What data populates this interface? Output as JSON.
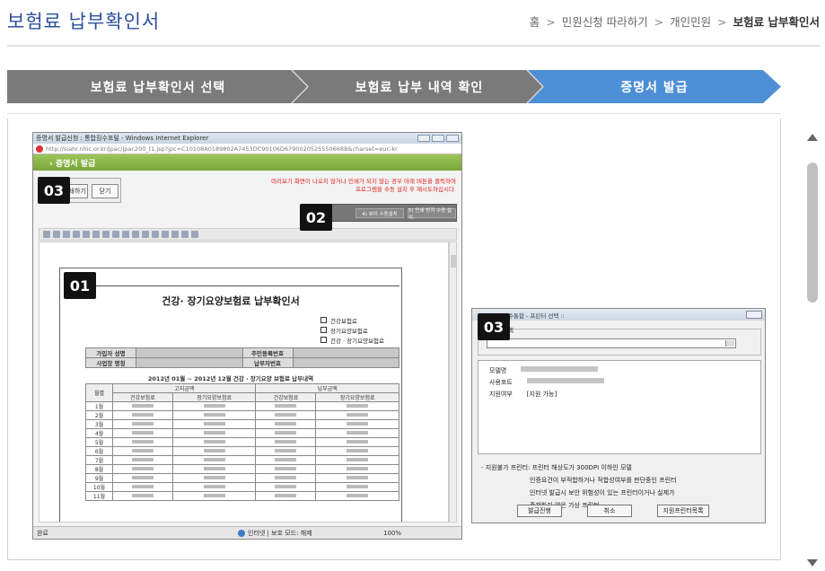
{
  "header": {
    "title": "보험료 납부확인서",
    "breadcrumb": [
      "홈",
      "민원신청 따라하기",
      "개인민원",
      "보험료 납부확인서"
    ],
    "separator": ">"
  },
  "steps": [
    {
      "label": "보험료 납부확인서 선택",
      "state": "done"
    },
    {
      "label": "보험료 납부 내역 확인",
      "state": "done"
    },
    {
      "label": "증명서 발급",
      "state": "active"
    }
  ],
  "colors": {
    "title": "#2b4f9c",
    "step_inactive": "#7a7a7a",
    "step_active": "#4d8fd6",
    "ie_green": "#7aa63a",
    "notice_red": "#e02020"
  },
  "ie_window": {
    "title": "증명서 발급신청 : 통합징수포털 - Windows Internet Explorer",
    "address": "http://siahr.nhic.or.kr/jpac/jpac200_t1.jsp?jpc=C10108A0189802A7453DC90106D6790020525550668B&charset=euc-kr",
    "green_bar": "› 증명서 발급",
    "notice_line1": "미리보기 화면이 나오지 않거나 인쇄가 되지 않는 경우 아래 버튼을 클릭하여",
    "notice_line2": "프로그램을 수동 설치 후 재시도하십시다.",
    "btn_print": "인쇄하기",
    "btn_close": "닫기",
    "btn_install1": "4) 뷰어 수동설치",
    "btn_install2": "5) 인쇄 방지 수동 설치",
    "status_left": "완료",
    "status_zone": "인터넷 | 보호 모드: 해제",
    "status_zoom": "100%"
  },
  "certificate": {
    "title": "건강· 장기요양보험료 납부확인서",
    "checks": [
      "건강보험료",
      "장기요양보험료",
      "건강 · 장기요양보험료"
    ],
    "label_name": "가입자 성명",
    "label_rrn": "주민등록번호",
    "label_company": "사업장 명칭",
    "label_payer": "납부자번호",
    "period": "2012년 01월 ~ 2012년 12월 건강 · 장기요양 보험료 납부내역",
    "col_month": "월별",
    "col_billed": "고지금액",
    "col_paid": "납부금액",
    "col_health": "건강보험료",
    "col_ltc": "장기요양보험료",
    "months": [
      "1월",
      "2월",
      "3월",
      "4월",
      "5월",
      "6월",
      "7월",
      "8월",
      "9월",
      "10월",
      "11월"
    ]
  },
  "printer_dialog": {
    "title": "징수통합 - 프린터 선택 ::",
    "select_label": "선택",
    "model_label": "모델명",
    "port_label": "사용포트",
    "support_label": "지원여부",
    "support_value": "[지원 가능]",
    "note_line1": "- 지원불가 프린터: 프린터 해상도가 300DPI 이하인 모델",
    "note_line2": "인증요건이 부적합하거나 적합성여부를 판단중인 프린터",
    "note_line3": "인터넷 발급시 보안 위험성이 있는 프린터이거나 실제가",
    "note_line4": "존재하지 않은 가상 프린터",
    "btn_issue": "발급진행",
    "btn_cancel": "취소",
    "btn_list": "지원프린터목록"
  },
  "badges": {
    "b1": "01",
    "b2": "02",
    "b3": "03"
  }
}
